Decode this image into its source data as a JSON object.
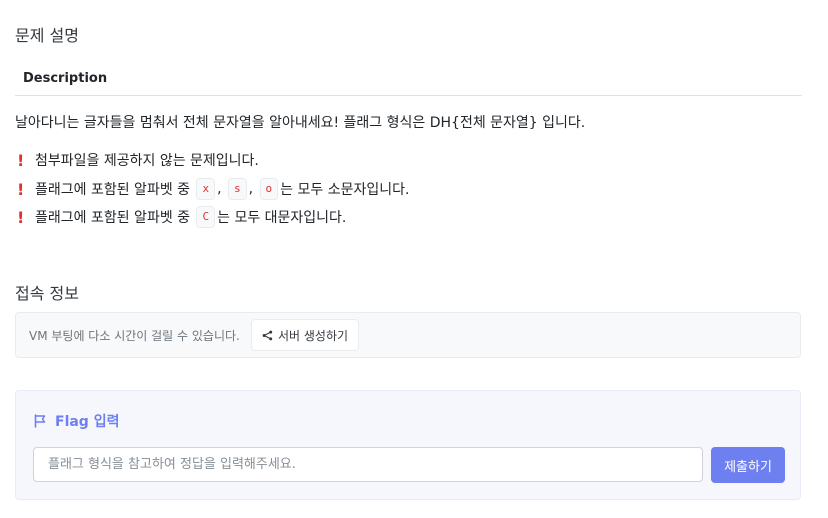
{
  "problem_section": {
    "title": "문제 설명",
    "tab_label": "Description",
    "intro": "날아다니는 글자들을 멈춰서 전체 문자열을 알아내세요! 플래그 형식은 DH{전체 문자열} 입니다.",
    "bullets": {
      "b1": {
        "icon": "!",
        "text": "첨부파일을 제공하지 않는 문제입니다."
      },
      "b2": {
        "icon": "!",
        "prefix": "플래그에 포함된 알파벳 중",
        "codes": [
          "x",
          "s",
          "o"
        ],
        "sep": ",",
        "suffix": "는 모두 소문자입니다."
      },
      "b3": {
        "icon": "!",
        "prefix": "플래그에 포함된 알파벳 중",
        "codes": [
          "C"
        ],
        "suffix": "는 모두 대문자입니다."
      }
    }
  },
  "connection_section": {
    "title": "접속 정보",
    "notice": "VM 부팅에 다소 시간이 걸릴 수 있습니다.",
    "server_button_label": "서버 생성하기",
    "server_button_icon": "share-icon"
  },
  "flag_section": {
    "title": "Flag 입력",
    "icon": "flag-icon",
    "input_placeholder": "플래그 형식을 참고하여 정답을 입력해주세요.",
    "input_value": "",
    "submit_label": "제출하기",
    "accent_color": "#6e7ff0"
  }
}
